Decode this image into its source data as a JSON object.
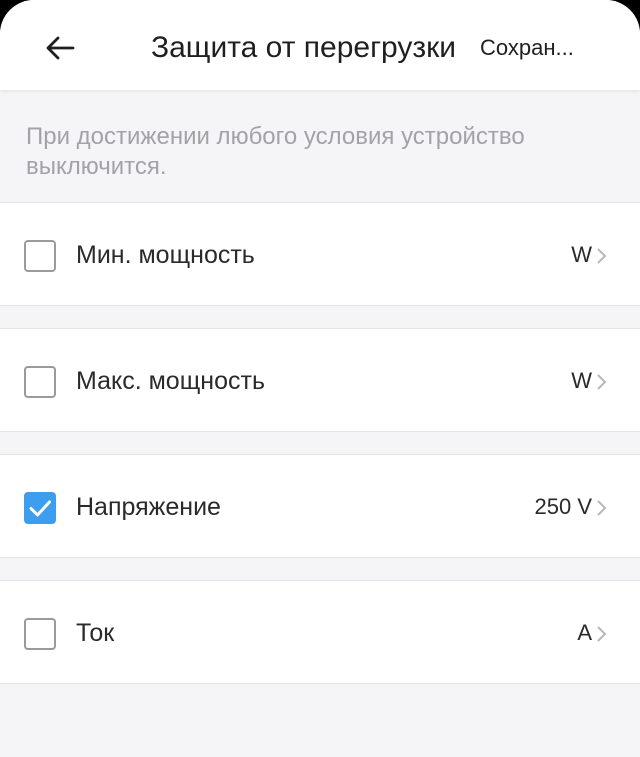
{
  "header": {
    "title": "Защита от перегрузки",
    "save_label": "Сохран..."
  },
  "hint": "При достижении любого условия устройство выключится.",
  "colors": {
    "accent": "#3d9dee",
    "background": "#f5f5f7",
    "hint_text": "#a2a2a8"
  },
  "conditions": [
    {
      "label": "Мин. мощность",
      "value": "W",
      "checked": false
    },
    {
      "label": "Макс. мощность",
      "value": "W",
      "checked": false
    },
    {
      "label": "Напряжение",
      "value": "250 V",
      "checked": true
    },
    {
      "label": "Ток",
      "value": "A",
      "checked": false
    }
  ]
}
